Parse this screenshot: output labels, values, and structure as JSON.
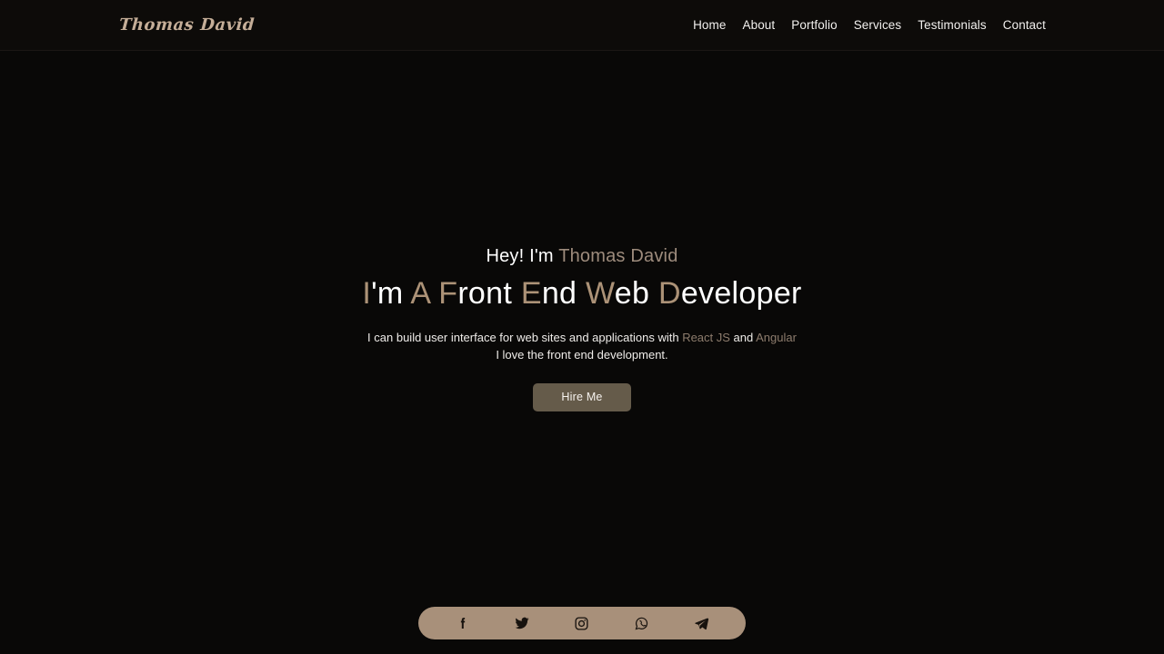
{
  "theme": {
    "background": "#090807",
    "header_background": "#0d0b09",
    "accent": "#ac9277",
    "accent_soft": "#9d8b7c",
    "button_background": "#655b4a",
    "social_bar_background": "#a8907a",
    "text": "#ffffff"
  },
  "header": {
    "logo_first": "Thomas",
    "logo_last": "David",
    "nav": [
      {
        "label": "Home",
        "name": "nav-link-home"
      },
      {
        "label": "About",
        "name": "nav-link-about"
      },
      {
        "label": "Portfolio",
        "name": "nav-link-portfolio"
      },
      {
        "label": "Services",
        "name": "nav-link-services"
      },
      {
        "label": "Testimonials",
        "name": "nav-link-testimonials"
      },
      {
        "label": "Contact",
        "name": "nav-link-contact"
      }
    ]
  },
  "hero": {
    "greeting_prefix": "Hey! I'm ",
    "greeting_name": "Thomas David",
    "title_parts": [
      {
        "cap": "I",
        "rest": "'m"
      },
      {
        "cap": "A",
        "rest": ""
      },
      {
        "cap": "F",
        "rest": "ront"
      },
      {
        "cap": "E",
        "rest": "nd"
      },
      {
        "cap": "W",
        "rest": "eb"
      },
      {
        "cap": "D",
        "rest": "eveloper"
      }
    ],
    "title_plain": "I'm A Front End Web Developer",
    "desc_line1_a": "I can build user interface for web sites and applications with ",
    "desc_tech1": "React JS",
    "desc_line1_b": " and ",
    "desc_tech2": "Angular",
    "desc_line2": "I love the front end development.",
    "cta_label": "Hire Me"
  },
  "social": [
    {
      "name": "facebook-icon",
      "label": "Facebook"
    },
    {
      "name": "twitter-icon",
      "label": "Twitter"
    },
    {
      "name": "instagram-icon",
      "label": "Instagram"
    },
    {
      "name": "whatsapp-icon",
      "label": "WhatsApp"
    },
    {
      "name": "telegram-icon",
      "label": "Telegram"
    }
  ]
}
